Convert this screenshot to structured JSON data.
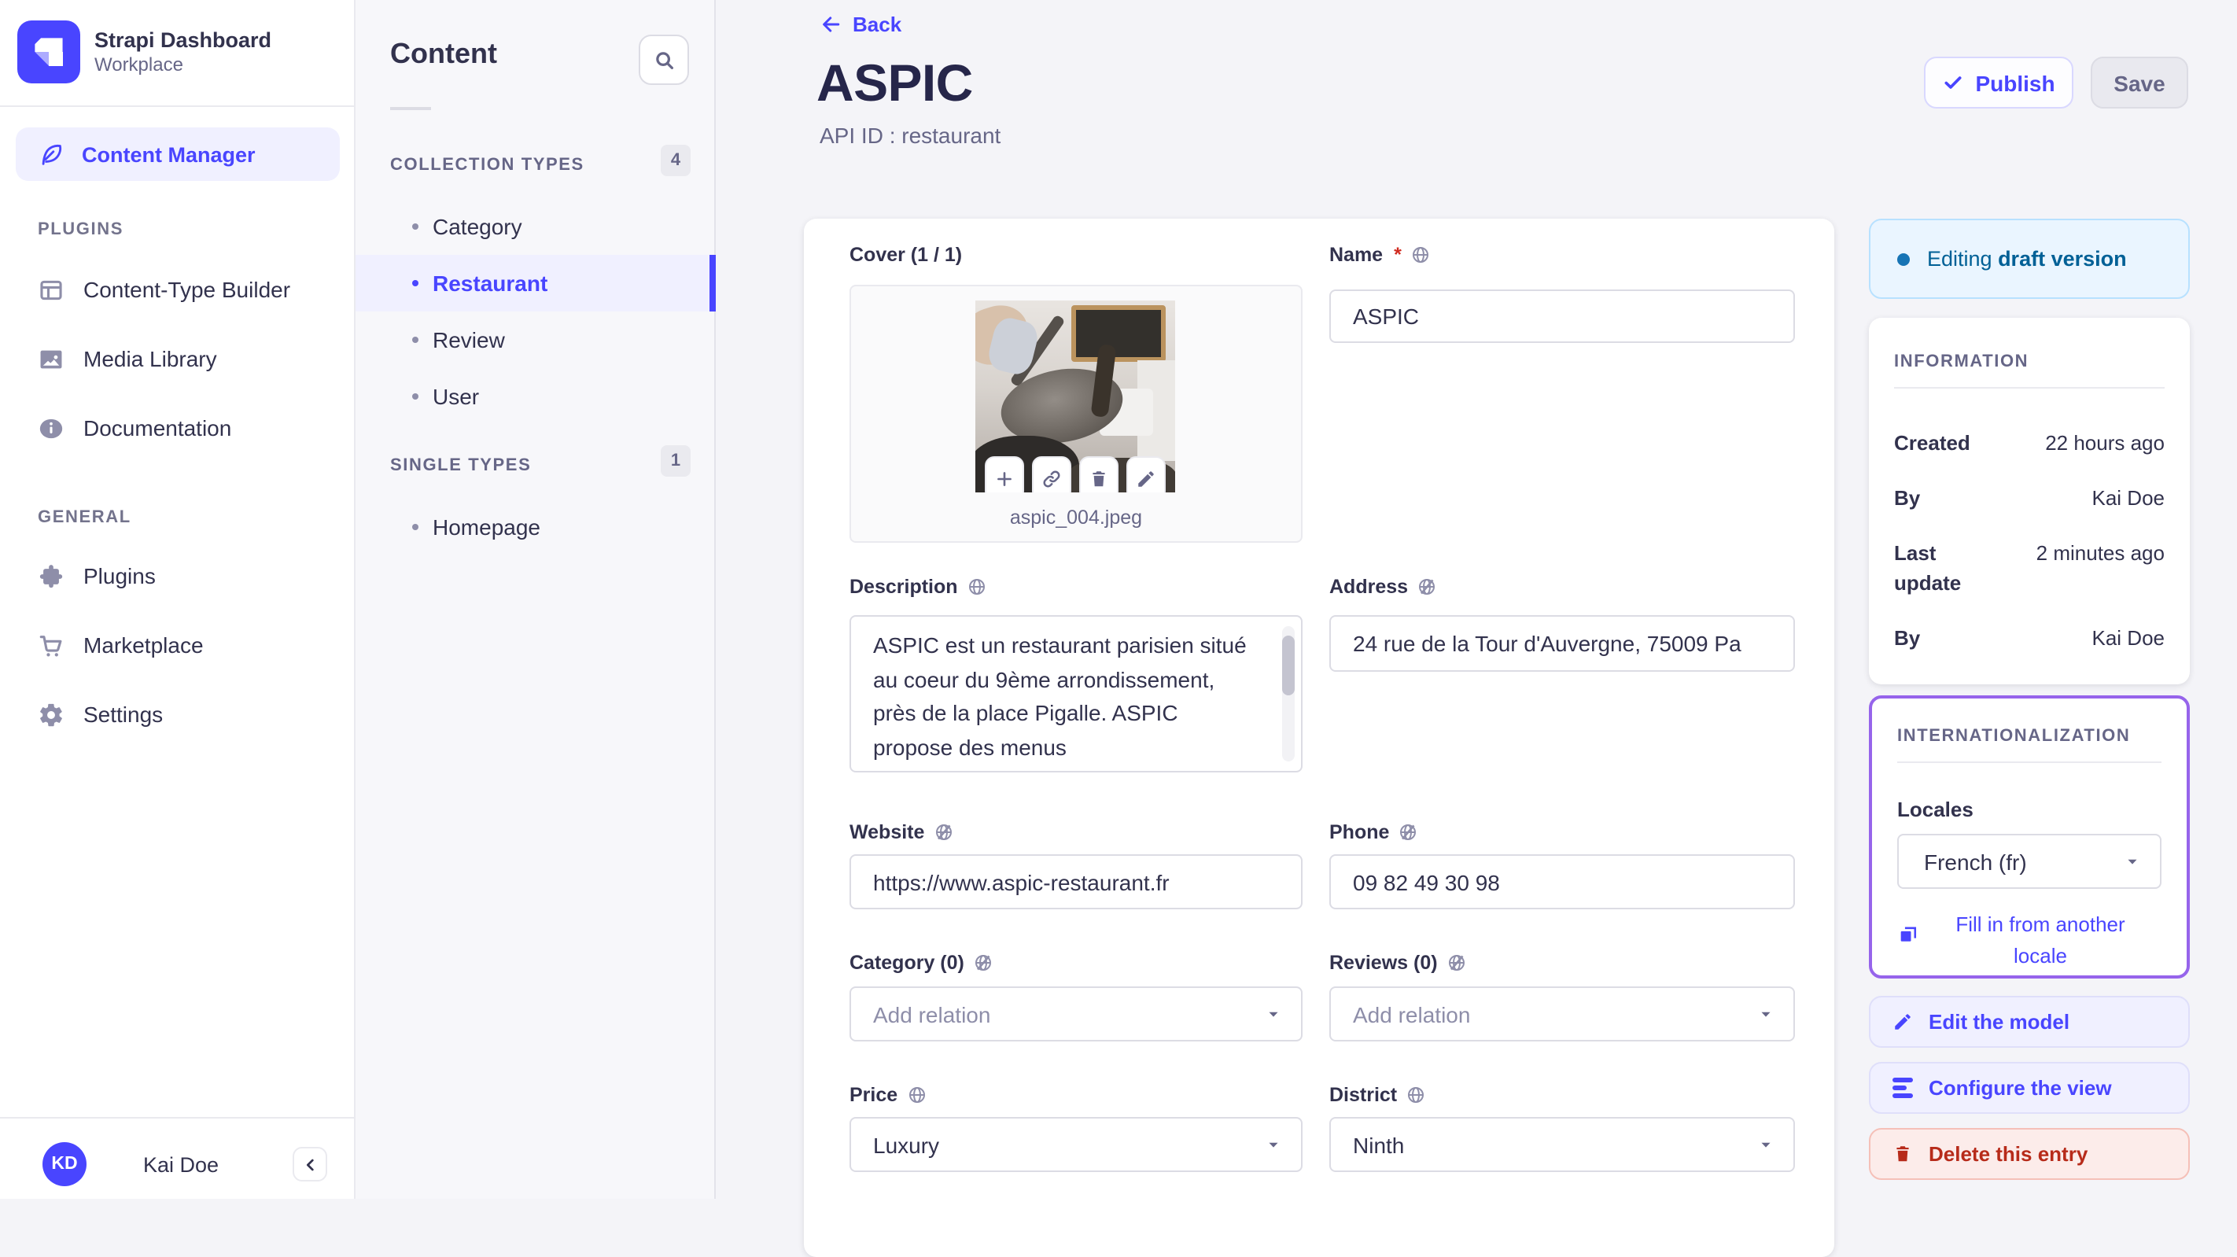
{
  "brand": {
    "title": "Strapi Dashboard",
    "subtitle": "Workplace",
    "user_initials": "KD",
    "user_name": "Kai Doe"
  },
  "nav": {
    "content_manager": "Content Manager",
    "sections": [
      {
        "header": "PLUGINS",
        "items": [
          {
            "label": "Content-Type Builder",
            "icon": "layout-icon"
          },
          {
            "label": "Media Library",
            "icon": "media-icon"
          },
          {
            "label": "Documentation",
            "icon": "info-icon"
          }
        ]
      },
      {
        "header": "GENERAL",
        "items": [
          {
            "label": "Plugins",
            "icon": "puzzle-icon"
          },
          {
            "label": "Marketplace",
            "icon": "cart-icon"
          },
          {
            "label": "Settings",
            "icon": "gear-icon"
          }
        ]
      }
    ]
  },
  "subnav": {
    "title": "Content",
    "groups": [
      {
        "header": "COLLECTION TYPES",
        "count": "4",
        "items": [
          {
            "label": "Category"
          },
          {
            "label": "Restaurant"
          },
          {
            "label": "Review"
          },
          {
            "label": "User"
          }
        ]
      },
      {
        "header": "SINGLE TYPES",
        "count": "1",
        "items": [
          {
            "label": "Homepage"
          }
        ]
      }
    ]
  },
  "header": {
    "back": "Back",
    "title": "ASPIC",
    "api_id": "API ID : restaurant",
    "publish": "Publish",
    "save": "Save"
  },
  "form": {
    "cover": {
      "label": "Cover (1 / 1)",
      "filename": "aspic_004.jpeg"
    },
    "name": {
      "label": "Name",
      "required": "*",
      "value": "ASPIC"
    },
    "description": {
      "label": "Description",
      "value": "ASPIC est un restaurant parisien situé au coeur du 9ème arrondissement, près de la place Pigalle. ASPIC propose des menus"
    },
    "address": {
      "label": "Address",
      "value": "24 rue de la Tour d'Auvergne, 75009 Pa"
    },
    "website": {
      "label": "Website",
      "value": "https://www.aspic-restaurant.fr"
    },
    "phone": {
      "label": "Phone",
      "value": "09 82 49 30 98"
    },
    "category": {
      "label": "Category (0)",
      "placeholder": "Add relation"
    },
    "reviews": {
      "label": "Reviews (0)",
      "placeholder": "Add relation"
    },
    "price": {
      "label": "Price",
      "value": "Luxury"
    },
    "district": {
      "label": "District",
      "value": "Ninth"
    }
  },
  "panel": {
    "draft": {
      "prefix": "Editing ",
      "bold": "draft version"
    },
    "information": {
      "title": "INFORMATION",
      "rows": [
        {
          "label": "Created",
          "value": "22 hours ago"
        },
        {
          "label": "By",
          "value": "Kai Doe"
        },
        {
          "label": "Last update",
          "value": "2 minutes ago"
        },
        {
          "label": "By",
          "value": "Kai Doe"
        }
      ]
    },
    "i18n": {
      "title": "INTERNATIONALIZATION",
      "locales_label": "Locales",
      "locale_value": "French (fr)",
      "fill_label": "Fill in from another locale"
    },
    "actions": [
      {
        "label": "Edit the model",
        "icon": "pencil-icon"
      },
      {
        "label": "Configure the view",
        "icon": "list-bars-icon"
      },
      {
        "label": "Delete this entry",
        "icon": "trash-icon"
      }
    ]
  },
  "colors": {
    "primary": "#4945ff",
    "danger": "#b72b1a",
    "draft_blue": "#006096",
    "i18n_purple": "#9664eb",
    "active_bg": "#f0f0ff"
  }
}
